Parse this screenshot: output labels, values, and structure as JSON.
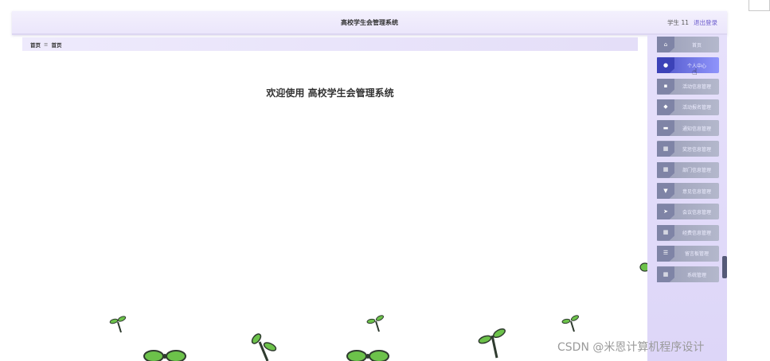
{
  "header": {
    "title": "高校学生会管理系统",
    "user_label": "学生 11",
    "logout_label": "退出登录"
  },
  "breadcrumb": {
    "home": "首页",
    "separator": "≡",
    "current": "首页"
  },
  "main": {
    "welcome": "欢迎使用 高校学生会管理系统"
  },
  "sidebar": {
    "items": [
      {
        "label": "首页",
        "icon": "home-icon",
        "glyph": "⌂",
        "active": false
      },
      {
        "label": "个人中心",
        "icon": "user-icon",
        "glyph": "●",
        "active": true
      },
      {
        "label": "活动信息管理",
        "icon": "file-icon",
        "glyph": "▪",
        "active": false
      },
      {
        "label": "活动报名管理",
        "icon": "tag-icon",
        "glyph": "◆",
        "active": false
      },
      {
        "label": "通知信息管理",
        "icon": "folder-icon",
        "glyph": "▬",
        "active": false
      },
      {
        "label": "奖惩信息管理",
        "icon": "grid-icon",
        "glyph": "▦",
        "active": false
      },
      {
        "label": "部门信息管理",
        "icon": "grid-icon",
        "glyph": "▦",
        "active": false
      },
      {
        "label": "意见信息管理",
        "icon": "comment-icon",
        "glyph": "▼",
        "active": false
      },
      {
        "label": "会议信息管理",
        "icon": "send-icon",
        "glyph": "➤",
        "active": false
      },
      {
        "label": "经费信息管理",
        "icon": "grid-icon",
        "glyph": "▦",
        "active": false
      },
      {
        "label": "留言板管理",
        "icon": "list-icon",
        "glyph": "☰",
        "active": false
      },
      {
        "label": "系统管理",
        "icon": "grid-icon",
        "glyph": "▦",
        "active": false
      }
    ]
  },
  "watermark": "CSDN @米恩计算机程序设计",
  "colors": {
    "accent": "#4e54c8",
    "sidebar_bg": "#e6e0fb",
    "sprout_leaf": "#6cc24a",
    "sprout_stem": "#2f3b2f"
  }
}
